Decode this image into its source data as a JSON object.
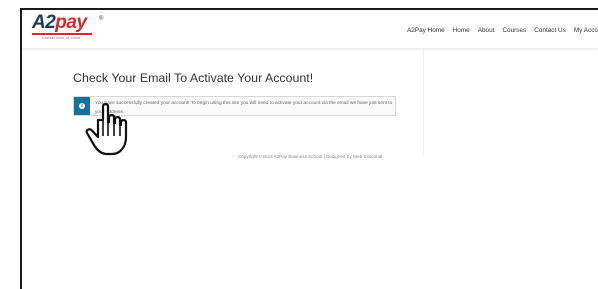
{
  "logo": {
    "brand_a": "A2",
    "brand_b": "pay",
    "reg_mark": "®",
    "tagline": "transactions of value"
  },
  "nav": {
    "items": [
      "A2Pay Home",
      "Home",
      "About",
      "Courses",
      "Contact Us",
      "My Acco"
    ]
  },
  "page": {
    "title": "Check Your Email To Activate Your Account!"
  },
  "alert": {
    "icon": "info-icon",
    "icon_glyph": "i",
    "message": "You have successfully created your account! To begin using this site you will need to activate your account via the email we have just sent to your address."
  },
  "footer": {
    "text": "Copyright ©2023 A2Pay Business School | Designed by Web Essential"
  },
  "overlay": {
    "cursor": "hand-pointer-icon"
  },
  "colors": {
    "brand_navy": "#1b3a5c",
    "brand_red": "#d12b2b",
    "alert_blue": "#14739c"
  }
}
